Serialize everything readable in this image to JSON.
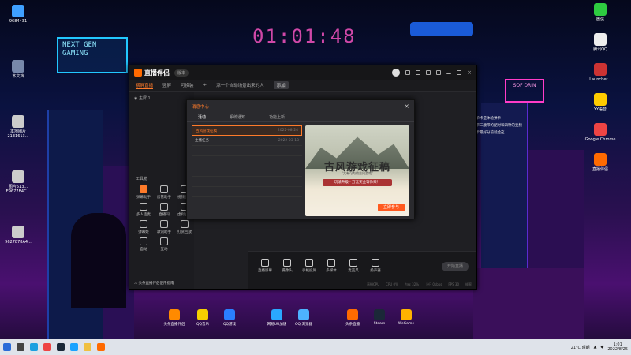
{
  "desktop": {
    "clock": "01:01:48",
    "neon_sign": "NEXT GEN GAMING",
    "left_icons": [
      {
        "label": "9684431",
        "color": "#3fa0ff"
      },
      {
        "label": "本文档",
        "color": "#7788aa"
      },
      {
        "label": "本地图片2131613...",
        "color": "#ccc"
      },
      {
        "label": "图片513... E9677B4C...",
        "color": "#ccc"
      },
      {
        "label": "9627878A4...",
        "color": "#ccc"
      }
    ],
    "right_icons": [
      {
        "label": "微信",
        "color": "#2ecc40"
      },
      {
        "label": "腾讯QQ",
        "color": "#eee"
      },
      {
        "label": "Launcher...",
        "color": "#c33"
      },
      {
        "label": "YY语音",
        "color": "#ffcc00"
      },
      {
        "label": "Google Chrome",
        "color": "#e44"
      },
      {
        "label": "直播伴侣",
        "color": "#ff6a00"
      }
    ],
    "right_notes": [
      "双记忆单卡是体验弹卡",
      "卡区域带三顺带的配对和四种的变频",
      "流出惊卡最好分前就给这"
    ],
    "dock": [
      {
        "label": "头条直播伴侣",
        "color": "#ff8a00"
      },
      {
        "label": "QQ音乐",
        "color": "#f5d000"
      },
      {
        "label": "QQ游戏",
        "color": "#2a7fff"
      },
      {
        "label": "网易UU加速",
        "color": "#2aa8ff"
      },
      {
        "label": "QQ 浏览器",
        "color": "#4db2ff"
      },
      {
        "label": "头条直播",
        "color": "#ff6a00"
      },
      {
        "label": "Steam",
        "color": "#1b2838"
      },
      {
        "label": "WeGame",
        "color": "#ffb300"
      }
    ]
  },
  "app": {
    "name": "直播伴侣",
    "version": "版本",
    "tabs": [
      "横屏直播",
      "竖屏",
      "可换装"
    ],
    "add_scene": "+",
    "scene_hint": "添一个自动场景出来的人",
    "scene_btn": "添加",
    "scene_row": "主屏 1",
    "tools_title": "工具箱",
    "tools": [
      "弹幕助手",
      "房管助手",
      "视频连麦",
      "多人连麦",
      "直播间",
      "虚拟主播",
      "弹幕姬",
      "歌词助手",
      "打赏回放",
      "自动",
      "互动"
    ],
    "bottom_buttons": [
      "直播屏幕",
      "摄像头",
      "手机投屏",
      "多媒体",
      "麦克风",
      "扬声器"
    ],
    "golive": "开始直播",
    "warning": "⚠ 头条直播伴侣使用指南",
    "status": [
      "直播CPU",
      "CPU 0%",
      "内存 32%",
      "上行 0kbps",
      "FPS 30",
      "帧率"
    ]
  },
  "modal": {
    "title": "消息中心",
    "tabs": [
      "活动",
      "系统通知",
      "功能上新"
    ],
    "rows": [
      {
        "title": "古风游戏征稿",
        "date": "2022-08-24",
        "selected": true
      },
      {
        "title": "主播任务",
        "date": "2022-03-18",
        "selected": false
      }
    ],
    "banner_title": "古风游戏征稿",
    "banner_subtitle": "“大有可为的古风游戏”",
    "banner_tag": "玩法升级 · 万元奖金等你来！",
    "banner_cta": "立即参与"
  },
  "taskbar": {
    "weather": "21°C 晴朗",
    "time": "1:01",
    "date": "2022/8/25"
  },
  "colors": {
    "accent": "#ff7b2a",
    "neon": "#22c8ff",
    "clock": "#d048a8"
  }
}
